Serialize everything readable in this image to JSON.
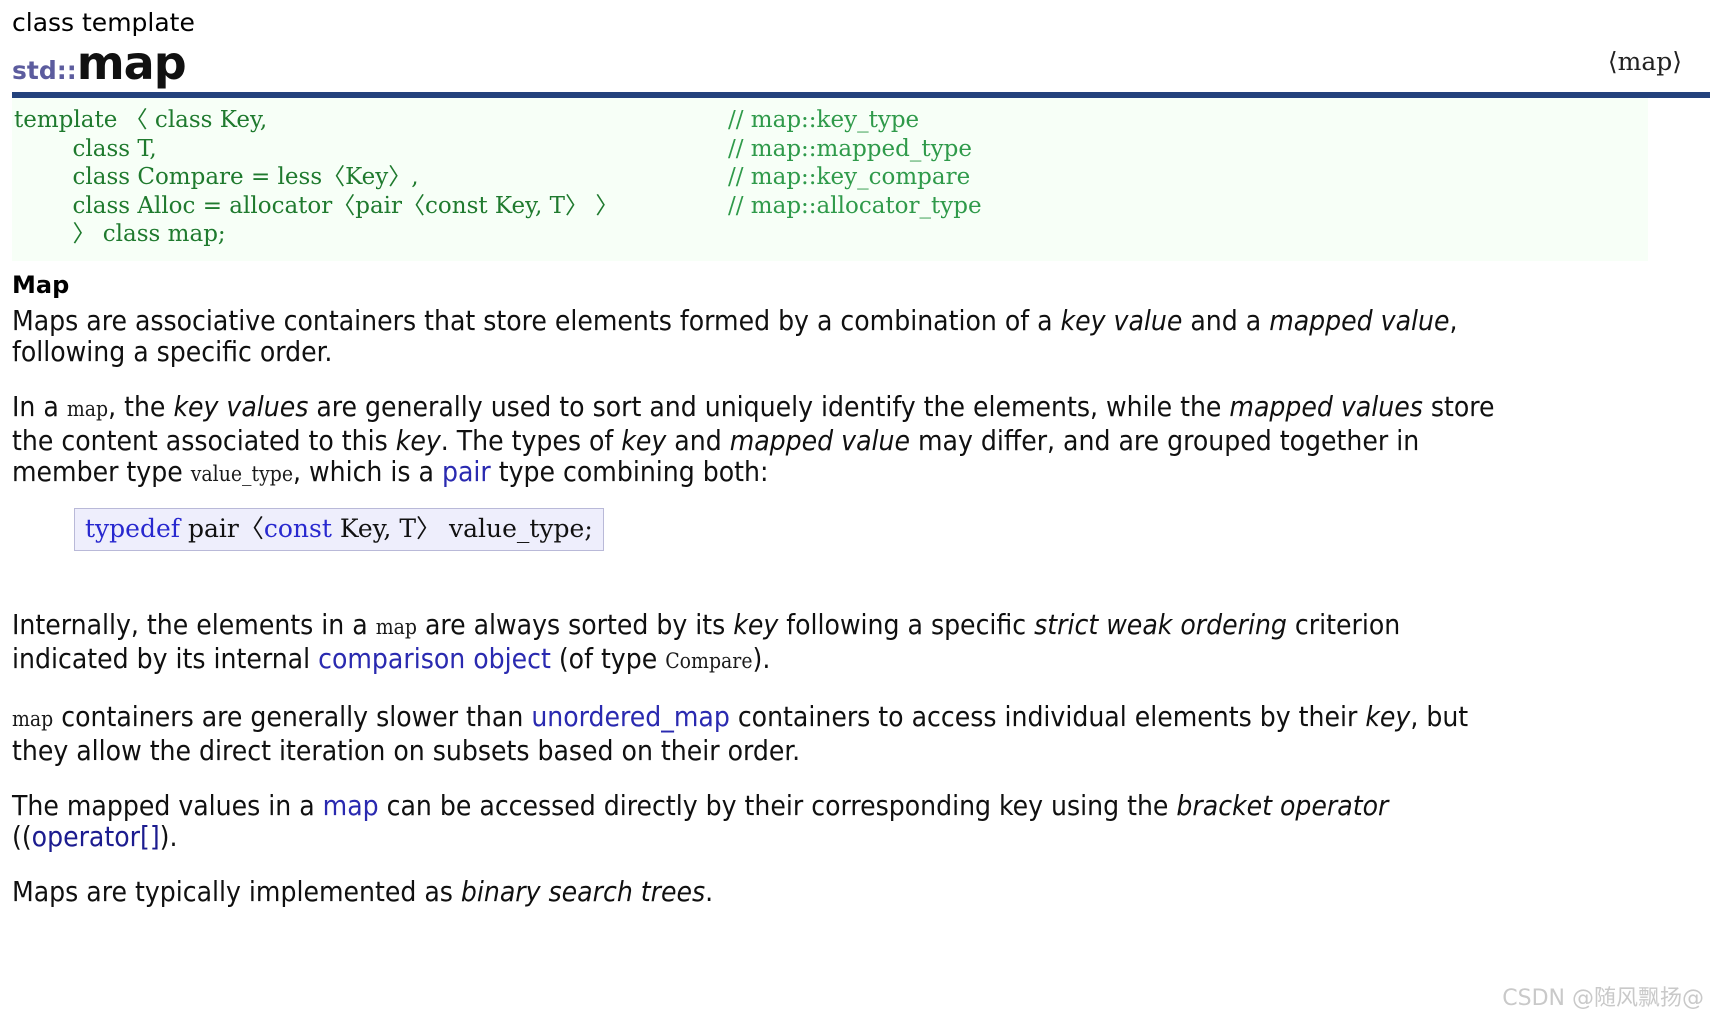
{
  "header": {
    "kicker": "class template",
    "namespace": "std::",
    "name": "map",
    "include": "⟨map⟩"
  },
  "signature": {
    "lines": [
      {
        "code": "template 〈 class Key,",
        "comment": "// map::key_type"
      },
      {
        "code": "        class T,",
        "comment": "// map::mapped_type"
      },
      {
        "code": "        class Compare = less〈Key〉,",
        "comment": "// map::key_compare"
      },
      {
        "code": "        class Alloc = allocator〈pair〈const Key, T〉 〉",
        "comment": "// map::allocator_type"
      },
      {
        "code": "        〉 class map;",
        "comment": ""
      }
    ]
  },
  "section": {
    "heading": "Map"
  },
  "paragraphs": {
    "p1": {
      "a": "Maps are associative containers that store elements formed by a combination of a ",
      "key_value": "key value",
      "b": " and a ",
      "mapped_value": "mapped value",
      "c": ", following a specific order."
    },
    "p2": {
      "a": "In a ",
      "code_map": "map",
      "b": ", the ",
      "key_values": "key values",
      "c": " are generally used to sort and uniquely identify the elements, while the ",
      "mapped_values": "mapped values",
      "d": " store the content associated to this ",
      "key": "key",
      "e": ". The types of ",
      "key2": "key",
      "f": " and ",
      "mapped_value2": "mapped value",
      "g": " may differ, and are grouped together in member type ",
      "code_value_type": "value_type",
      "h": ", which is a ",
      "link_pair": "pair",
      "i": " type combining both:"
    },
    "typedef": {
      "kw_typedef": "typedef",
      "mid": " pair〈",
      "kw_const": "const",
      "tail": " Key, T〉 value_type;"
    },
    "p3": {
      "a": "Internally, the elements in a ",
      "code_map": "map",
      "b": " are always sorted by its ",
      "key": "key",
      "c": " following a specific ",
      "strict_weak_ordering": "strict weak ordering",
      "d": " criterion indicated by its internal ",
      "link_comparison_object": "comparison object",
      "e": " (of type ",
      "code_compare": "Compare",
      "f": ")."
    },
    "p4": {
      "code_map": "map",
      "a": " containers are generally slower than ",
      "link_unordered_map": "unordered_map",
      "b": " containers to access individual elements by their ",
      "key": "key",
      "c": ", but they allow the direct iteration on subsets based on their order."
    },
    "p5": {
      "a": "The mapped values in a ",
      "link_map": "map",
      "b": " can be accessed directly by their corresponding key using the ",
      "bracket_operator": "bracket operator",
      "c": " ((",
      "link_operator": "operator[]",
      "d": ")."
    },
    "p6": {
      "a": "Maps are typically implemented as ",
      "binary_search_trees": "binary search trees",
      "b": "."
    }
  },
  "watermark": {
    "text": "CSDN @随风飘扬@"
  },
  "colors": {
    "rule": "#23427c",
    "namespace": "#5c5c9e",
    "code_block_bg": "#f7fff7",
    "code_green": "#1f7a2e",
    "comment_green": "#2f9a4a",
    "link_blue": "#2a2ab0",
    "typedef_bg": "#eeeefc",
    "typedef_border": "#b9b9d8",
    "watermark": "#c9c9c9"
  }
}
